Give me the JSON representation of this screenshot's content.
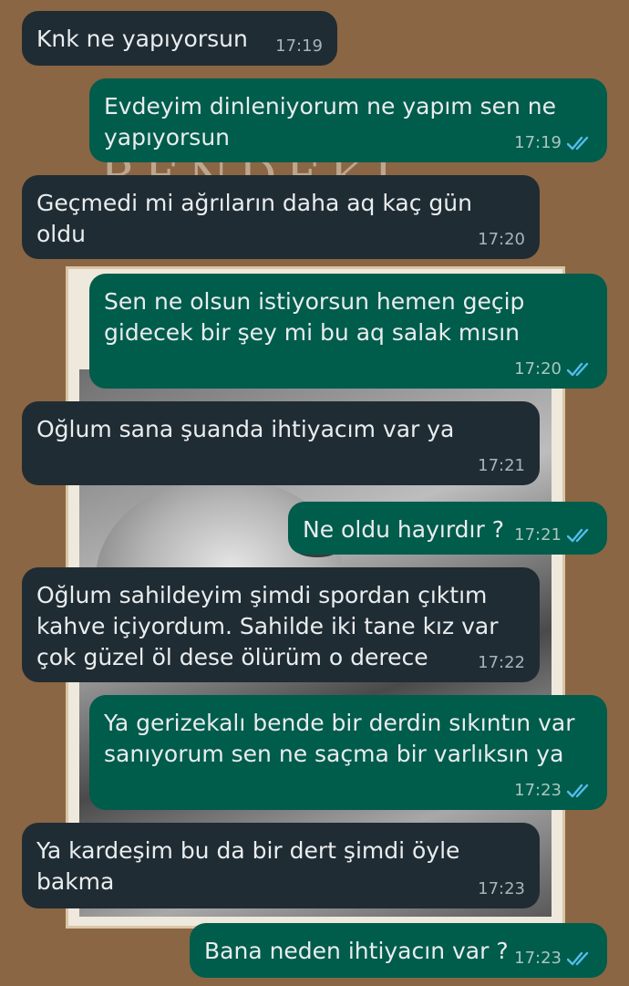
{
  "wallpaper": {
    "title_fragment": "BENDEKİ SEN"
  },
  "messages": [
    {
      "direction": "in",
      "text": "Knk ne yapıyorsun",
      "time": "17:19"
    },
    {
      "direction": "out",
      "text": "Evdeyim dinleniyorum ne yapım sen ne\nyapıyorsun",
      "time": "17:19",
      "status": "read"
    },
    {
      "direction": "in",
      "text": "Geçmedi mi ağrıların daha aq kaç gün oldu",
      "time": "17:20"
    },
    {
      "direction": "out",
      "text": "Sen ne olsun istiyorsun hemen geçip\ngidecek bir şey mi bu aq salak mısın",
      "time": "17:20",
      "status": "read"
    },
    {
      "direction": "in",
      "text": "Oğlum sana şuanda ihtiyacım var ya",
      "time": "17:21"
    },
    {
      "direction": "out",
      "text": "Ne oldu hayırdır ?",
      "time": "17:21",
      "status": "read"
    },
    {
      "direction": "in",
      "text": "Oğlum sahildeyim şimdi spordan çıktım\nkahve içiyordum. Sahilde iki tane kız var\nçok güzel öl dese ölürüm o derece",
      "time": "17:22"
    },
    {
      "direction": "out",
      "text": "Ya gerizekalı bende bir derdin sıkıntın var\nsanıyorum sen ne saçma bir varlıksın ya",
      "time": "17:23",
      "status": "read"
    },
    {
      "direction": "in",
      "text": "Ya kardeşim bu da bir dert şimdi öyle\nbakma",
      "time": "17:23"
    },
    {
      "direction": "out",
      "text": "Bana neden ihtiyacın var ?",
      "time": "17:23",
      "status": "read"
    }
  ],
  "colors": {
    "incoming_bubble": "#202c33",
    "outgoing_bubble": "#005c4b",
    "read_check": "#53bdeb",
    "wallpaper": "#8a6644"
  },
  "icons": {
    "read_status": "double-check-icon"
  }
}
